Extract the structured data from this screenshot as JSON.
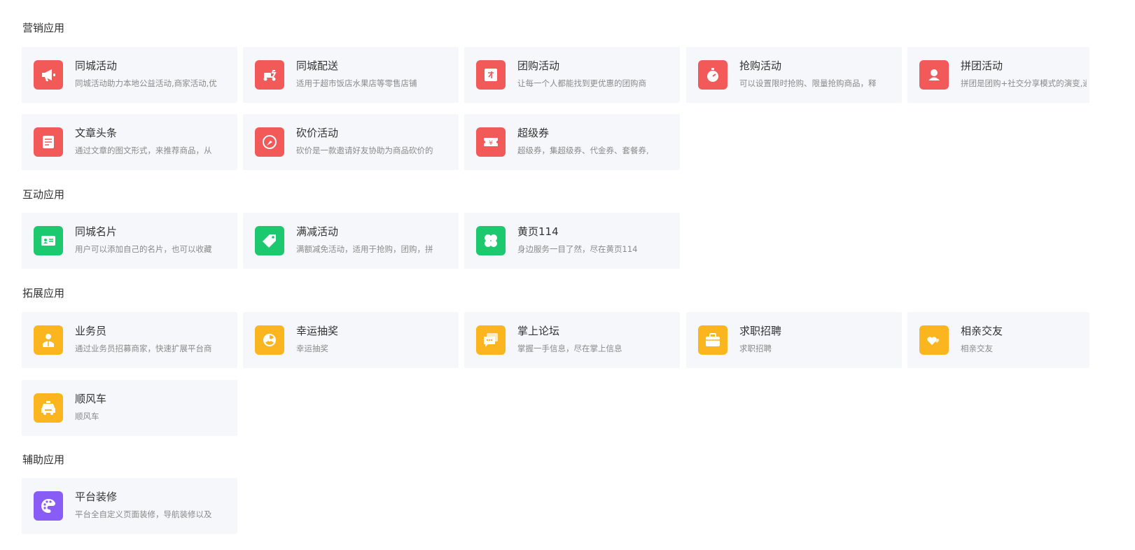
{
  "sections": [
    {
      "title": "营销应用",
      "apps": [
        {
          "name": "同城活动",
          "desc": "同城活动助力本地公益活动,商家活动,优",
          "icon": "megaphone-icon",
          "color": "#f25a5a"
        },
        {
          "name": "同城配送",
          "desc": "适用于超市饭店水果店等零售店铺",
          "icon": "scooter-icon",
          "color": "#f25a5a"
        },
        {
          "name": "团购活动",
          "desc": "让每一个人都能找到更优惠的团购商",
          "icon": "group-buy-icon",
          "color": "#f25a5a"
        },
        {
          "name": "抢购活动",
          "desc": "可以设置限时抢购、限量抢购商品，释",
          "icon": "stopwatch-icon",
          "color": "#f25a5a"
        },
        {
          "name": "拼团活动",
          "desc": "拼团是团购+社交分享模式的演变,通",
          "icon": "team-icon",
          "color": "#f25a5a"
        },
        {
          "name": "文章头条",
          "desc": "通过文章的图文形式，来推荐商品，从",
          "icon": "article-icon",
          "color": "#f25a5a"
        },
        {
          "name": "砍价活动",
          "desc": "砍价是一款邀请好友协助为商品砍价的",
          "icon": "axe-icon",
          "color": "#f25a5a"
        },
        {
          "name": "超级券",
          "desc": "超级券，集超级券、代金券、套餐券,",
          "icon": "coupon-icon",
          "color": "#f25a5a"
        }
      ]
    },
    {
      "title": "互动应用",
      "apps": [
        {
          "name": "同城名片",
          "desc": "用户可以添加自己的名片，也可以收藏",
          "icon": "business-card-icon",
          "color": "#1dc96f"
        },
        {
          "name": "满减活动",
          "desc": "满额减免活动，适用于抢购，团购，拼",
          "icon": "price-tag-icon",
          "color": "#1dc96f"
        },
        {
          "name": "黄页114",
          "desc": "身边服务一目了然，尽在黄页114",
          "icon": "clover-icon",
          "color": "#1dc96f"
        }
      ]
    },
    {
      "title": "拓展应用",
      "apps": [
        {
          "name": "业务员",
          "desc": "通过业务员招募商家，快速扩展平台商",
          "icon": "salesman-icon",
          "color": "#fbb51f"
        },
        {
          "name": "幸运抽奖",
          "desc": "幸运抽奖",
          "icon": "lottery-wheel-icon",
          "color": "#fbb51f"
        },
        {
          "name": "掌上论坛",
          "desc": "掌握一手信息，尽在掌上信息",
          "icon": "chat-bubbles-icon",
          "color": "#fbb51f"
        },
        {
          "name": "求职招聘",
          "desc": "求职招聘",
          "icon": "briefcase-icon",
          "color": "#fbb51f"
        },
        {
          "name": "相亲交友",
          "desc": "相亲交友",
          "icon": "hearts-icon",
          "color": "#fbb51f"
        },
        {
          "name": "顺风车",
          "desc": "顺风车",
          "icon": "taxi-icon",
          "color": "#fbb51f"
        }
      ]
    },
    {
      "title": "辅助应用",
      "apps": [
        {
          "name": "平台装修",
          "desc": "平台全自定义页面装修，导航装修以及",
          "icon": "palette-icon",
          "color": "#8a5cf6"
        }
      ]
    }
  ]
}
